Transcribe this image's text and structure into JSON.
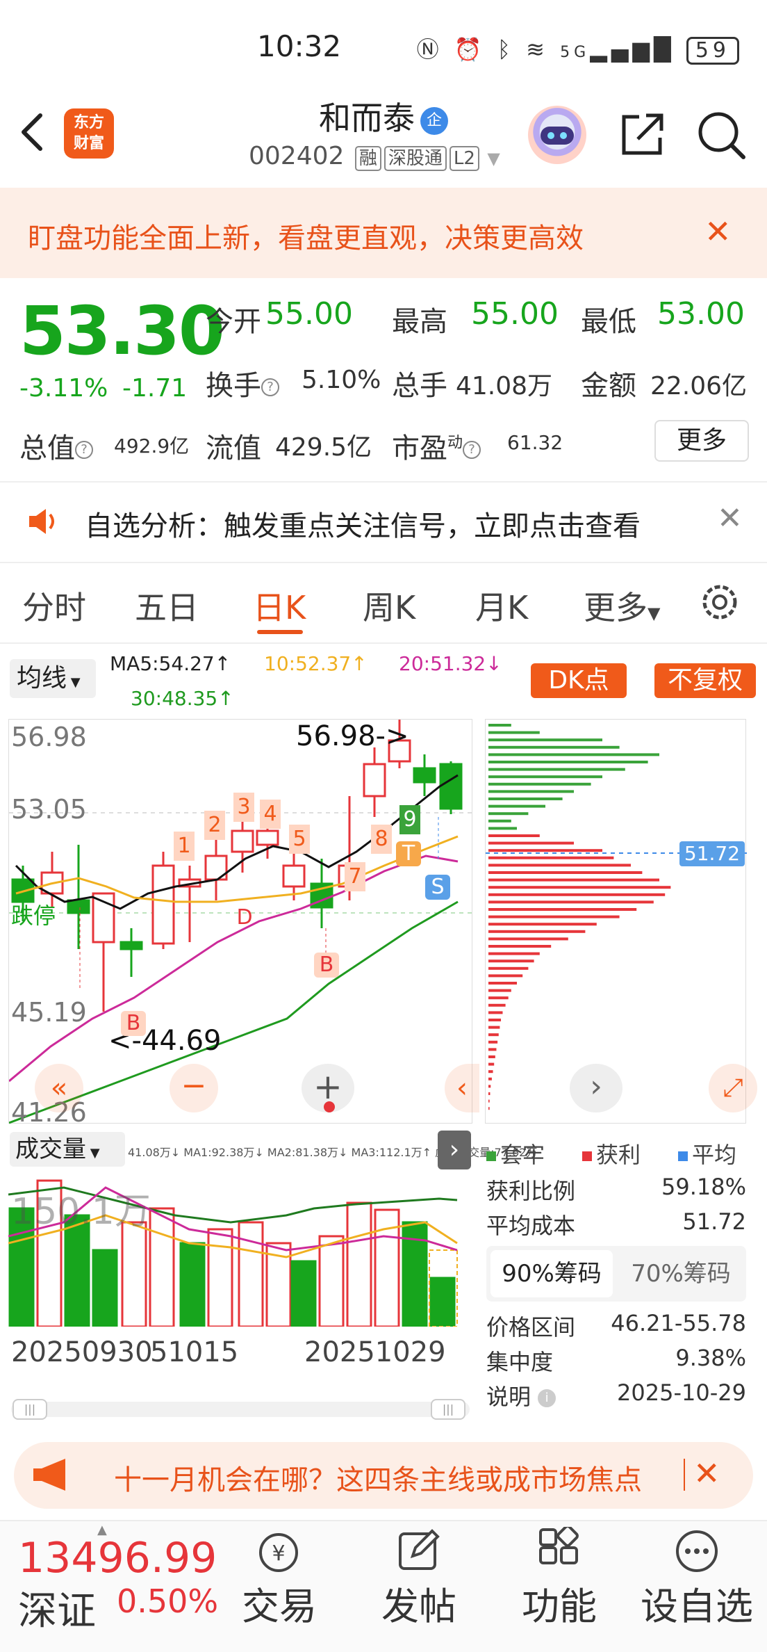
{
  "status_bar": {
    "time": "10:32",
    "network": "5G",
    "battery": "59"
  },
  "header": {
    "logo_line1": "东方",
    "logo_line2": "财富",
    "stock_name": "和而泰",
    "name_badge": "企",
    "stock_code": "002402",
    "tags": [
      "融",
      "深股通",
      "L2"
    ]
  },
  "banner": {
    "text": "盯盘功能全面上新，看盘更直观，决策更高效"
  },
  "quote": {
    "price": "53.30",
    "change_pct": "-3.11%",
    "change_amt": "-1.71",
    "open_label": "今开",
    "open": "55.00",
    "high_label": "最高",
    "high": "55.00",
    "low_label": "最低",
    "low": "53.00",
    "turnover_label": "换手",
    "turnover": "5.10%",
    "volume_label": "总手",
    "volume": "41.08万",
    "amount_label": "金额",
    "amount": "22.06亿",
    "mktcap_label": "总值",
    "mktcap": "492.9亿",
    "float_label": "流值",
    "float": "429.5亿",
    "pe_label": "市盈",
    "pe_sup": "动",
    "pe": "61.32",
    "more_label": "更多"
  },
  "analysis": {
    "text": "自选分析：触发重点关注信号，立即点击查看"
  },
  "tabs": [
    "分时",
    "五日",
    "日K",
    "周K",
    "月K",
    "更多"
  ],
  "indicator": {
    "selector": "均线",
    "ma5": "MA5:54.27↑",
    "ma10": "10:52.37↑",
    "ma20": "20:51.32↓",
    "ma30": "30:48.35↑",
    "dk_button": "DK点",
    "adjust_button": "不复权"
  },
  "kline": {
    "y_labels": [
      "56.98",
      "53.05",
      "45.19",
      "41.26"
    ],
    "high_marker": "56.98->",
    "low_marker": "<-44.69",
    "limit_label": "跌停",
    "signal_numbers": [
      "1",
      "2",
      "3",
      "4",
      "5",
      "7",
      "8",
      "9"
    ],
    "signal_letters": [
      "B",
      "B",
      "D",
      "T",
      "S"
    ],
    "chip_avg": "51.72"
  },
  "volume_panel": {
    "selector": "成交量",
    "legend": "41.08万↓  MA1:92.38万↓  MA2:81.38万↓  MA3:112.1万↑  虚拟成交量:77.62万",
    "y_label": "150.1万",
    "x_labels": [
      "20250930",
      "51015",
      "20251029"
    ]
  },
  "chip_panel": {
    "legend": [
      "套牢",
      "获利",
      "平均"
    ],
    "profit_ratio_label": "获利比例",
    "profit_ratio": "59.18%",
    "avg_cost_label": "平均成本",
    "avg_cost": "51.72",
    "seg_on": "90%筹码",
    "seg_off": "70%筹码",
    "price_range_label": "价格区间",
    "price_range": "46.21-55.78",
    "concentration_label": "集中度",
    "concentration": "9.38%",
    "note_label": "说明",
    "note": "2025-10-29"
  },
  "promo": {
    "text": "十一月机会在哪？这四条主线或成市场焦点"
  },
  "bottom": {
    "index_value": "13496.99",
    "index_name": "深证",
    "index_pct": "0.50%",
    "nav": [
      "交易",
      "发帖",
      "功能",
      "设自选"
    ]
  },
  "colors": {
    "up": "#e6353a",
    "down": "#17a51d",
    "accent": "#f05a1a",
    "ma5": "#111111",
    "ma10": "#f0b020",
    "ma20": "#cc2a99",
    "ma30": "#1f9a1f"
  }
}
